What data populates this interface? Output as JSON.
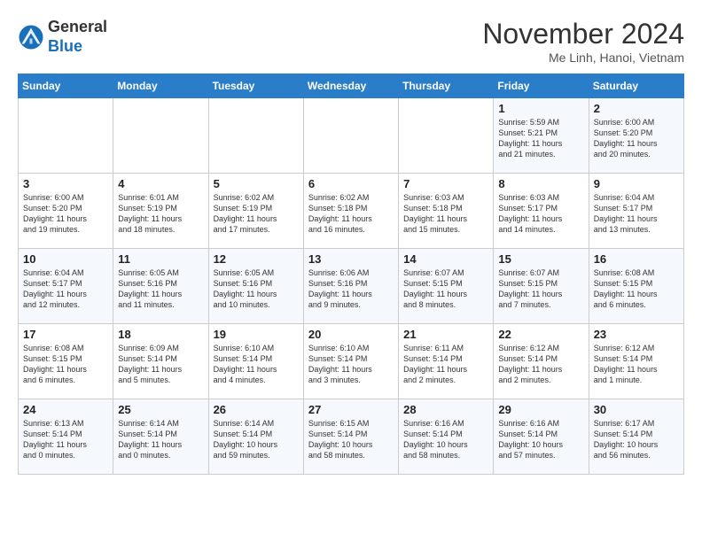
{
  "header": {
    "logo_line1": "General",
    "logo_line2": "Blue",
    "month": "November 2024",
    "location": "Me Linh, Hanoi, Vietnam"
  },
  "days_of_week": [
    "Sunday",
    "Monday",
    "Tuesday",
    "Wednesday",
    "Thursday",
    "Friday",
    "Saturday"
  ],
  "weeks": [
    [
      {
        "num": "",
        "info": ""
      },
      {
        "num": "",
        "info": ""
      },
      {
        "num": "",
        "info": ""
      },
      {
        "num": "",
        "info": ""
      },
      {
        "num": "",
        "info": ""
      },
      {
        "num": "1",
        "info": "Sunrise: 5:59 AM\nSunset: 5:21 PM\nDaylight: 11 hours\nand 21 minutes."
      },
      {
        "num": "2",
        "info": "Sunrise: 6:00 AM\nSunset: 5:20 PM\nDaylight: 11 hours\nand 20 minutes."
      }
    ],
    [
      {
        "num": "3",
        "info": "Sunrise: 6:00 AM\nSunset: 5:20 PM\nDaylight: 11 hours\nand 19 minutes."
      },
      {
        "num": "4",
        "info": "Sunrise: 6:01 AM\nSunset: 5:19 PM\nDaylight: 11 hours\nand 18 minutes."
      },
      {
        "num": "5",
        "info": "Sunrise: 6:02 AM\nSunset: 5:19 PM\nDaylight: 11 hours\nand 17 minutes."
      },
      {
        "num": "6",
        "info": "Sunrise: 6:02 AM\nSunset: 5:18 PM\nDaylight: 11 hours\nand 16 minutes."
      },
      {
        "num": "7",
        "info": "Sunrise: 6:03 AM\nSunset: 5:18 PM\nDaylight: 11 hours\nand 15 minutes."
      },
      {
        "num": "8",
        "info": "Sunrise: 6:03 AM\nSunset: 5:17 PM\nDaylight: 11 hours\nand 14 minutes."
      },
      {
        "num": "9",
        "info": "Sunrise: 6:04 AM\nSunset: 5:17 PM\nDaylight: 11 hours\nand 13 minutes."
      }
    ],
    [
      {
        "num": "10",
        "info": "Sunrise: 6:04 AM\nSunset: 5:17 PM\nDaylight: 11 hours\nand 12 minutes."
      },
      {
        "num": "11",
        "info": "Sunrise: 6:05 AM\nSunset: 5:16 PM\nDaylight: 11 hours\nand 11 minutes."
      },
      {
        "num": "12",
        "info": "Sunrise: 6:05 AM\nSunset: 5:16 PM\nDaylight: 11 hours\nand 10 minutes."
      },
      {
        "num": "13",
        "info": "Sunrise: 6:06 AM\nSunset: 5:16 PM\nDaylight: 11 hours\nand 9 minutes."
      },
      {
        "num": "14",
        "info": "Sunrise: 6:07 AM\nSunset: 5:15 PM\nDaylight: 11 hours\nand 8 minutes."
      },
      {
        "num": "15",
        "info": "Sunrise: 6:07 AM\nSunset: 5:15 PM\nDaylight: 11 hours\nand 7 minutes."
      },
      {
        "num": "16",
        "info": "Sunrise: 6:08 AM\nSunset: 5:15 PM\nDaylight: 11 hours\nand 6 minutes."
      }
    ],
    [
      {
        "num": "17",
        "info": "Sunrise: 6:08 AM\nSunset: 5:15 PM\nDaylight: 11 hours\nand 6 minutes."
      },
      {
        "num": "18",
        "info": "Sunrise: 6:09 AM\nSunset: 5:14 PM\nDaylight: 11 hours\nand 5 minutes."
      },
      {
        "num": "19",
        "info": "Sunrise: 6:10 AM\nSunset: 5:14 PM\nDaylight: 11 hours\nand 4 minutes."
      },
      {
        "num": "20",
        "info": "Sunrise: 6:10 AM\nSunset: 5:14 PM\nDaylight: 11 hours\nand 3 minutes."
      },
      {
        "num": "21",
        "info": "Sunrise: 6:11 AM\nSunset: 5:14 PM\nDaylight: 11 hours\nand 2 minutes."
      },
      {
        "num": "22",
        "info": "Sunrise: 6:12 AM\nSunset: 5:14 PM\nDaylight: 11 hours\nand 2 minutes."
      },
      {
        "num": "23",
        "info": "Sunrise: 6:12 AM\nSunset: 5:14 PM\nDaylight: 11 hours\nand 1 minute."
      }
    ],
    [
      {
        "num": "24",
        "info": "Sunrise: 6:13 AM\nSunset: 5:14 PM\nDaylight: 11 hours\nand 0 minutes."
      },
      {
        "num": "25",
        "info": "Sunrise: 6:14 AM\nSunset: 5:14 PM\nDaylight: 11 hours\nand 0 minutes."
      },
      {
        "num": "26",
        "info": "Sunrise: 6:14 AM\nSunset: 5:14 PM\nDaylight: 10 hours\nand 59 minutes."
      },
      {
        "num": "27",
        "info": "Sunrise: 6:15 AM\nSunset: 5:14 PM\nDaylight: 10 hours\nand 58 minutes."
      },
      {
        "num": "28",
        "info": "Sunrise: 6:16 AM\nSunset: 5:14 PM\nDaylight: 10 hours\nand 58 minutes."
      },
      {
        "num": "29",
        "info": "Sunrise: 6:16 AM\nSunset: 5:14 PM\nDaylight: 10 hours\nand 57 minutes."
      },
      {
        "num": "30",
        "info": "Sunrise: 6:17 AM\nSunset: 5:14 PM\nDaylight: 10 hours\nand 56 minutes."
      }
    ]
  ]
}
